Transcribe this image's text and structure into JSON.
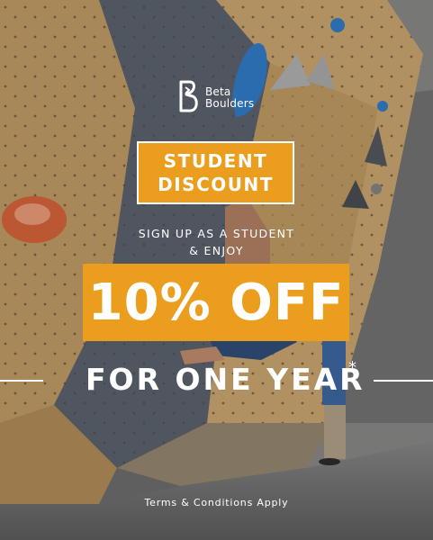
{
  "brand": {
    "name_line1": "Beta",
    "name_line2": "Boulders",
    "logo_icon": "b-logo-icon"
  },
  "headline": {
    "line1": "STUDENT",
    "line2": "DISCOUNT"
  },
  "subheading": {
    "line1": "SIGN UP AS A STUDENT",
    "line2": "& ENJOY"
  },
  "offer": {
    "discount": "10% OFF",
    "duration": "FOR ONE YEAR",
    "asterisk": "*"
  },
  "footer": {
    "terms": "Terms & Conditions Apply"
  },
  "colors": {
    "accent": "#eb9d1e",
    "text": "#ffffff",
    "wall": "#c9a268",
    "concrete": "#7a7b7a",
    "hold_blue": "#2f7fd0",
    "hold_orange": "#e0663a"
  }
}
